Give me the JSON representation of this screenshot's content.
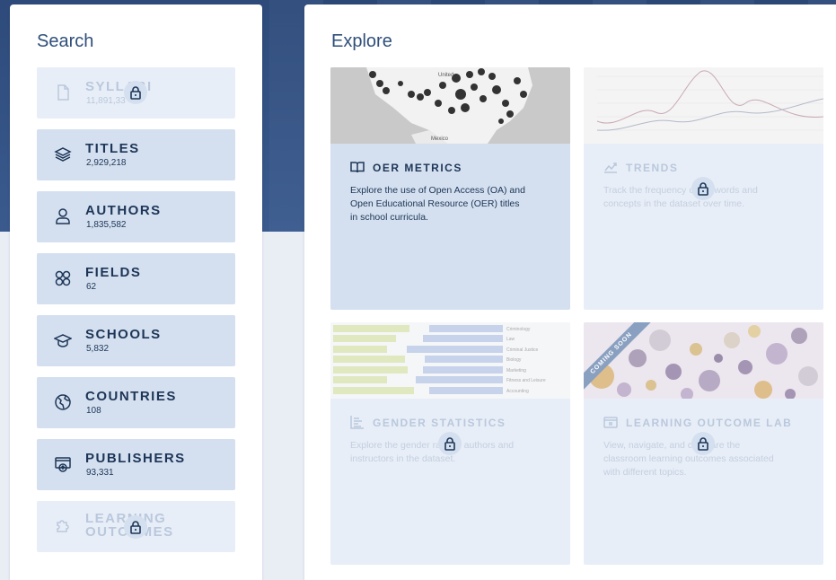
{
  "search": {
    "title": "Search",
    "items": [
      {
        "label": "SYLLABI",
        "count": "11,891,33",
        "icon": "document-icon",
        "locked": true
      },
      {
        "label": "TITLES",
        "count": "2,929,218",
        "icon": "book-stack-icon",
        "locked": false
      },
      {
        "label": "AUTHORS",
        "count": "1,835,582",
        "icon": "person-icon",
        "locked": false
      },
      {
        "label": "FIELDS",
        "count": "62",
        "icon": "fields-icon",
        "locked": false
      },
      {
        "label": "SCHOOLS",
        "count": "5,832",
        "icon": "graduation-cap-icon",
        "locked": false
      },
      {
        "label": "COUNTRIES",
        "count": "108",
        "icon": "globe-icon",
        "locked": false
      },
      {
        "label": "PUBLISHERS",
        "count": "93,331",
        "icon": "publisher-icon",
        "locked": false
      },
      {
        "label": "LEARNING",
        "label2": "OUTCOMES",
        "icon": "puzzle-icon",
        "locked": true
      }
    ]
  },
  "explore": {
    "title": "Explore",
    "cards": [
      {
        "title": "OER METRICS",
        "desc": "Explore the use of Open Access (OA) and Open Educational Resource (OER) titles in school curricula.",
        "icon": "open-book-icon",
        "locked": false,
        "map_labels": [
          "United",
          "Mexico"
        ]
      },
      {
        "title": "TRENDS",
        "desc": "Track the frequency of keywords and concepts in the dataset over time.",
        "icon": "trend-line-icon",
        "locked": true
      },
      {
        "title": "GENDER STATISTICS",
        "desc": "Explore the gender ratio of authors and instructors in the dataset.",
        "icon": "bar-chart-icon",
        "locked": true,
        "bar_labels": [
          "Criminology",
          "Law",
          "Criminal Justice",
          "Biology",
          "Marketing",
          "Fitness and Leisure",
          "Accounting"
        ]
      },
      {
        "title": "LEARNING OUTCOME LAB",
        "desc": "View, navigate, and compare the classroom learning outcomes associated with different topics.",
        "icon": "lab-icon",
        "locked": true,
        "badge": "COMING SOON"
      }
    ]
  },
  "colors": {
    "hero": "#2d4a7a",
    "item": "#d4e0ef",
    "item_locked": "#e8eef7",
    "text": "#1d3557"
  }
}
